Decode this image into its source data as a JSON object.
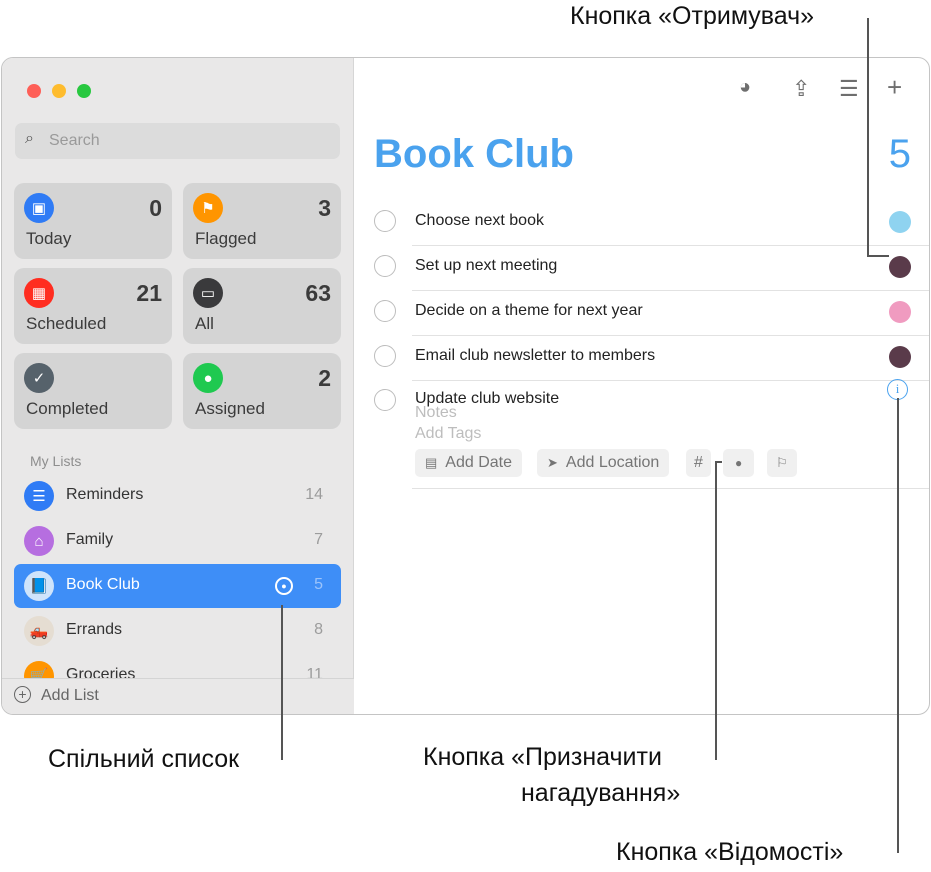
{
  "sidebar": {
    "search_placeholder": "Search",
    "tiles": [
      {
        "label": "Today",
        "count": "0",
        "icon": "calendar-icon",
        "color": "#2f7bf5"
      },
      {
        "label": "Flagged",
        "count": "3",
        "icon": "flag-icon",
        "color": "#ff9500"
      },
      {
        "label": "Scheduled",
        "count": "21",
        "icon": "calendar-grid-icon",
        "color": "#ff2d20"
      },
      {
        "label": "All",
        "count": "63",
        "icon": "tray-icon",
        "color": "#3a3a3c"
      },
      {
        "label": "Completed",
        "count": "",
        "icon": "checkmark-icon",
        "color": "#56626b"
      },
      {
        "label": "Assigned",
        "count": "2",
        "icon": "person-icon",
        "color": "#1fc950"
      }
    ],
    "section_title": "My Lists",
    "lists": [
      {
        "label": "Reminders",
        "count": "14",
        "icon": "list-icon",
        "color": "#2f7bf5"
      },
      {
        "label": "Family",
        "count": "7",
        "icon": "house-icon",
        "color": "#b66ee0"
      },
      {
        "label": "Book Club",
        "count": "5",
        "icon": "book-icon",
        "color": "#cfe4fb",
        "shared": true
      },
      {
        "label": "Errands",
        "count": "8",
        "icon": "truck-icon",
        "color": "#e5ddd2"
      },
      {
        "label": "Groceries",
        "count": "11",
        "icon": "cart-icon",
        "color": "#ff9500"
      }
    ],
    "add_list": "Add List"
  },
  "main": {
    "title": "Book Club",
    "count": "5",
    "accent": "#4aa2ee",
    "reminders": [
      {
        "text": "Choose next book",
        "avatar": "#8fd3f0"
      },
      {
        "text": "Set up next meeting",
        "avatar": "#5a3b4a"
      },
      {
        "text": "Decide on a theme for next year",
        "avatar": "#f09bc0"
      },
      {
        "text": "Email club newsletter to members",
        "avatar": "#5a3b4a"
      },
      {
        "text": "Update club website"
      }
    ],
    "notes_placeholder": "Notes",
    "tags_placeholder": "Add Tags",
    "add_date": "Add Date",
    "add_location": "Add Location",
    "tag_symbol": "#"
  },
  "callouts": {
    "assignee": "Кнопка «Отримувач»",
    "shared_list": "Спільний список",
    "assign_line1": "Кнопка «Призначити",
    "assign_line2": "нагадування»",
    "info": "Кнопка «Відомості»"
  }
}
